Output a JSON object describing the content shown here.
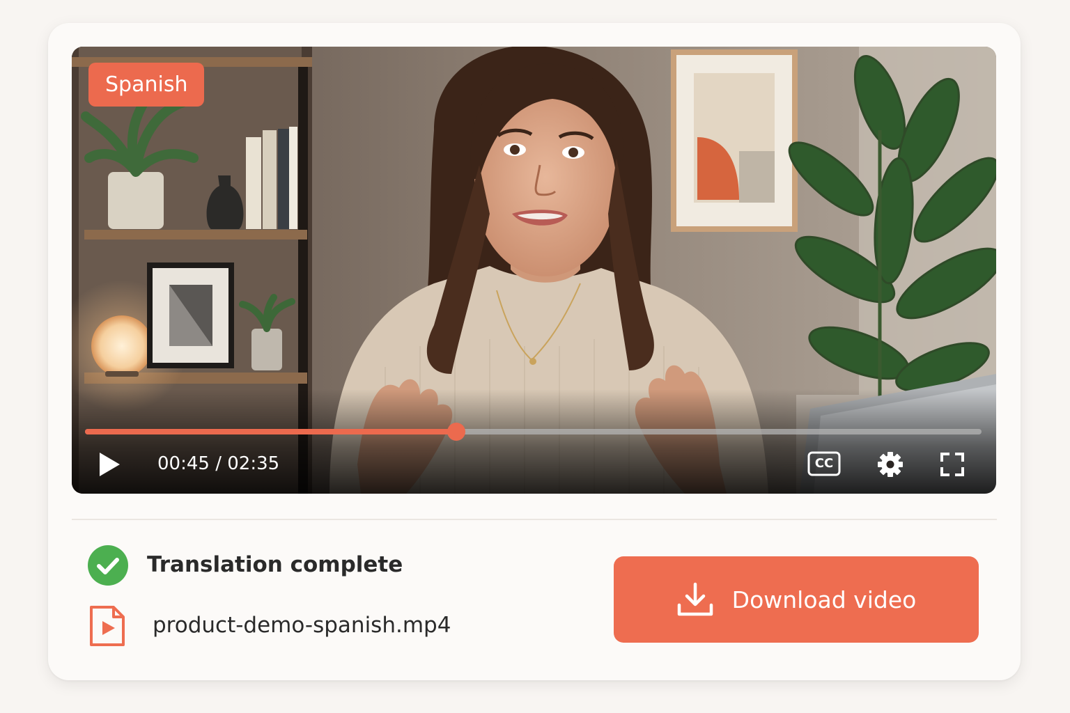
{
  "player": {
    "language_badge": "Spanish",
    "progress_fraction": 0.414,
    "current_time": "00:45",
    "duration": "02:35",
    "time_display": "00:45 / 02:35",
    "cc_label": "CC"
  },
  "status": {
    "text": "Translation complete",
    "icon": "check-circle-icon"
  },
  "file": {
    "name": "product-demo-spanish.mp4",
    "icon": "video-file-icon"
  },
  "download": {
    "label": "Download video",
    "icon": "download-icon"
  },
  "colors": {
    "accent": "#ee6d50",
    "success": "#4caf50",
    "text": "#2a2a2a",
    "card": "#fcfaf8",
    "page": "#f8f5f2"
  }
}
